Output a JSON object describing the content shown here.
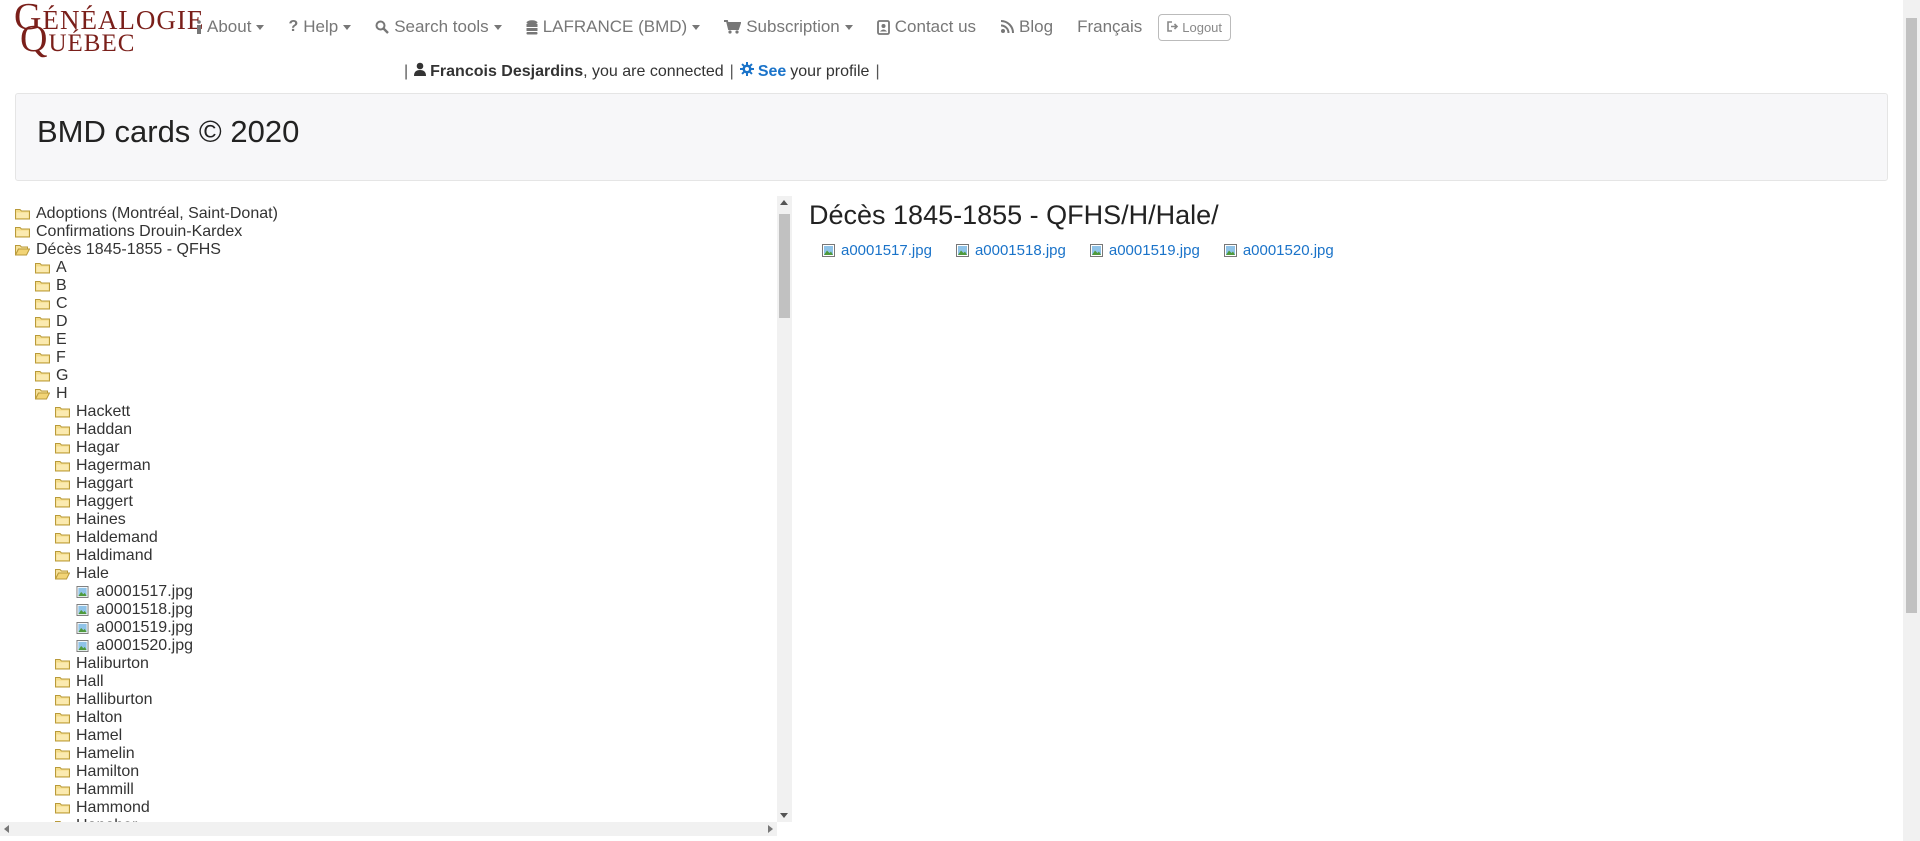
{
  "logo": {
    "line1_initial": "G",
    "line1_rest": "ÉNÉALOGIE",
    "line2_initial": "Q",
    "line2_rest": "UÉBEC"
  },
  "nav": {
    "items": [
      {
        "label": "About",
        "icon": "info-icon",
        "dropdown": true
      },
      {
        "label": "Help",
        "icon": "question-icon",
        "dropdown": true
      },
      {
        "label": "Search tools",
        "icon": "search-icon",
        "dropdown": true
      },
      {
        "label": "LAFRANCE (BMD)",
        "icon": "database-icon",
        "dropdown": true
      },
      {
        "label": "Subscription",
        "icon": "cart-icon",
        "dropdown": true
      },
      {
        "label": "Contact us",
        "icon": "contact-card-icon",
        "dropdown": false
      },
      {
        "label": "Blog",
        "icon": "rss-icon",
        "dropdown": false
      },
      {
        "label": "Français",
        "icon": "",
        "dropdown": false
      }
    ],
    "logout_label": "Logout"
  },
  "user": {
    "separator": "|",
    "name": "Francois Desjardins",
    "connected_text": ", you are connected",
    "see_label": "See",
    "profile_text": "your profile"
  },
  "jumbotron": {
    "title": "BMD cards © 2020"
  },
  "tree": [
    {
      "label": "Adoptions (Montréal, Saint-Donat)",
      "type": "folder",
      "level": 0,
      "open": false
    },
    {
      "label": "Confirmations Drouin-Kardex",
      "type": "folder",
      "level": 0,
      "open": false
    },
    {
      "label": "Décès 1845-1855 - QFHS",
      "type": "folder",
      "level": 0,
      "open": true
    },
    {
      "label": "A",
      "type": "folder",
      "level": 1,
      "open": false
    },
    {
      "label": "B",
      "type": "folder",
      "level": 1,
      "open": false
    },
    {
      "label": "C",
      "type": "folder",
      "level": 1,
      "open": false
    },
    {
      "label": "D",
      "type": "folder",
      "level": 1,
      "open": false
    },
    {
      "label": "E",
      "type": "folder",
      "level": 1,
      "open": false
    },
    {
      "label": "F",
      "type": "folder",
      "level": 1,
      "open": false
    },
    {
      "label": "G",
      "type": "folder",
      "level": 1,
      "open": false
    },
    {
      "label": "H",
      "type": "folder",
      "level": 1,
      "open": true
    },
    {
      "label": "Hackett",
      "type": "folder",
      "level": 2,
      "open": false
    },
    {
      "label": "Haddan",
      "type": "folder",
      "level": 2,
      "open": false
    },
    {
      "label": "Hagar",
      "type": "folder",
      "level": 2,
      "open": false
    },
    {
      "label": "Hagerman",
      "type": "folder",
      "level": 2,
      "open": false
    },
    {
      "label": "Haggart",
      "type": "folder",
      "level": 2,
      "open": false
    },
    {
      "label": "Haggert",
      "type": "folder",
      "level": 2,
      "open": false
    },
    {
      "label": "Haines",
      "type": "folder",
      "level": 2,
      "open": false
    },
    {
      "label": "Haldemand",
      "type": "folder",
      "level": 2,
      "open": false
    },
    {
      "label": "Haldimand",
      "type": "folder",
      "level": 2,
      "open": false
    },
    {
      "label": "Hale",
      "type": "folder",
      "level": 2,
      "open": true
    },
    {
      "label": "a0001517.jpg",
      "type": "file",
      "level": 3,
      "open": false
    },
    {
      "label": "a0001518.jpg",
      "type": "file",
      "level": 3,
      "open": false
    },
    {
      "label": "a0001519.jpg",
      "type": "file",
      "level": 3,
      "open": false
    },
    {
      "label": "a0001520.jpg",
      "type": "file",
      "level": 3,
      "open": false
    },
    {
      "label": "Haliburton",
      "type": "folder",
      "level": 2,
      "open": false
    },
    {
      "label": "Hall",
      "type": "folder",
      "level": 2,
      "open": false
    },
    {
      "label": "Halliburton",
      "type": "folder",
      "level": 2,
      "open": false
    },
    {
      "label": "Halton",
      "type": "folder",
      "level": 2,
      "open": false
    },
    {
      "label": "Hamel",
      "type": "folder",
      "level": 2,
      "open": false
    },
    {
      "label": "Hamelin",
      "type": "folder",
      "level": 2,
      "open": false
    },
    {
      "label": "Hamilton",
      "type": "folder",
      "level": 2,
      "open": false
    },
    {
      "label": "Hammill",
      "type": "folder",
      "level": 2,
      "open": false
    },
    {
      "label": "Hammond",
      "type": "folder",
      "level": 2,
      "open": false
    },
    {
      "label": "Hanaher",
      "type": "folder",
      "level": 2,
      "open": false
    }
  ],
  "content": {
    "title": "Décès 1845-1855 - QFHS/H/Hale/",
    "files": [
      "a0001517.jpg",
      "a0001518.jpg",
      "a0001519.jpg",
      "a0001520.jpg"
    ]
  },
  "colors": {
    "brand": "#7a1f1a",
    "link": "#1a73c9",
    "nav_text": "#777777",
    "folder": "#f2d476"
  }
}
